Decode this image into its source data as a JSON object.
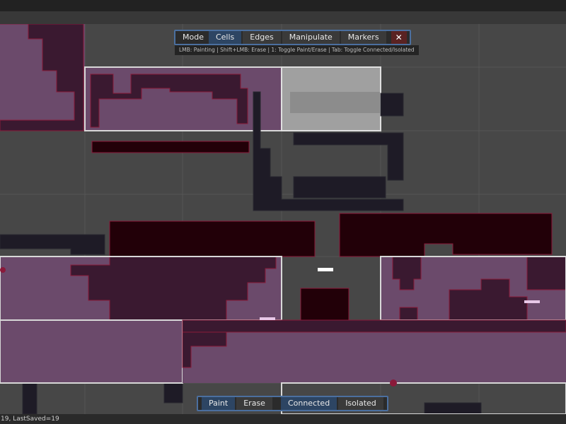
{
  "top_toolbar": {
    "mode_label": "Mode",
    "buttons": [
      "Cells",
      "Edges",
      "Manipulate",
      "Markers"
    ],
    "active": "Cells",
    "close_symbol": "✕",
    "close_icon": "close-icon"
  },
  "hint": "LMB: Painting | Shift+LMB: Erase | 1: Toggle Paint/Erase | Tab: Toggle Connected/Isolated",
  "bottom_toolbar": {
    "paint": "Paint",
    "erase": "Erase",
    "connected": "Connected",
    "isolated": "Isolated",
    "active_tool": "Paint",
    "active_mode": "Connected"
  },
  "status": "19, LastSaved=19",
  "colors": {
    "canvas": "#474747",
    "room_fill": "#6b4a6b",
    "solid_tile": "#3a1930",
    "dark_solid": "#220008",
    "connected_tile": "#1e1b26",
    "selected_room": "#a0a0a0",
    "accent_border": "#4b6f9f"
  }
}
